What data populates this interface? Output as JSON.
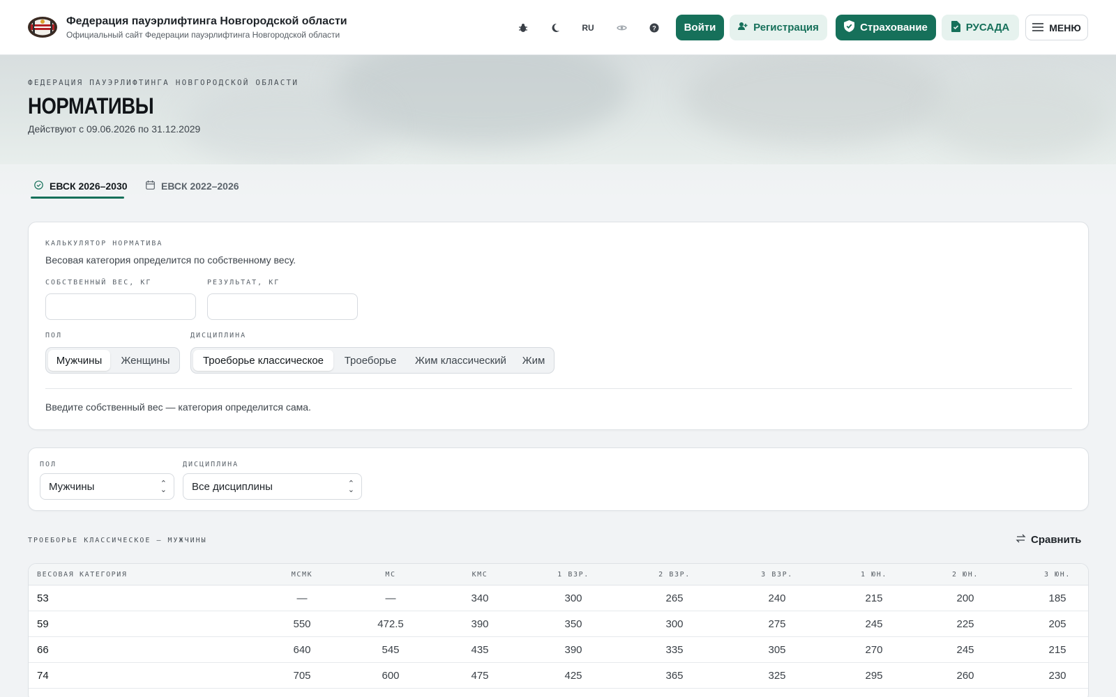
{
  "header": {
    "title": "Федерация пауэрлифтинга Новгородской области",
    "subtitle": "Официальный сайт Федерации пауэрлифтинга Новгородской области",
    "icons": [
      "bug-icon",
      "moon-icon",
      "eye-icon",
      "help-icon"
    ],
    "lang": "RU",
    "login": "Войти",
    "register": "Регистрация",
    "insurance": "Страхование",
    "rusada": "РУСАДА",
    "menu": "МЕНЮ"
  },
  "hero": {
    "kicker": "ФЕДЕРАЦИЯ ПАУЭРЛИФТИНГА НОВГОРОДСКОЙ ОБЛАСТИ",
    "title": "НОРМАТИВЫ",
    "dates": "Действуют с 09.06.2026 по 31.12.2029"
  },
  "tabs": [
    {
      "label": "ЕВСК 2026–2030",
      "active": true
    },
    {
      "label": "ЕВСК 2022–2026",
      "active": false
    }
  ],
  "calculator": {
    "title": "КАЛЬКУЛЯТОР НОРМАТИВА",
    "description": "Весовая категория определится по собственному весу.",
    "bodyweight_label": "СОБСТВЕННЫЙ ВЕС, КГ",
    "bodyweight_value": "",
    "result_label": "РЕЗУЛЬТАТ, КГ",
    "result_value": "",
    "sex_label": "ПОЛ",
    "sex_options": [
      "Мужчины",
      "Женщины"
    ],
    "sex_selected": "Мужчины",
    "discipline_label": "ДИСЦИПЛИНА",
    "discipline_options": [
      "Троеборье классическое",
      "Троеборье",
      "Жим классический",
      "Жим"
    ],
    "discipline_selected": "Троеборье классическое",
    "hint": "Введите собственный вес — категория определится сама."
  },
  "filters": {
    "sex_label": "ПОЛ",
    "sex_value": "Мужчины",
    "discipline_label": "ДИСЦИПЛИНА",
    "discipline_value": "Все дисциплины"
  },
  "table": {
    "title": "ТРОЕБОРЬЕ КЛАССИЧЕСКОЕ — МУЖЧИНЫ",
    "compare": "Сравнить",
    "headers": [
      "ВЕСОВАЯ КАТЕГОРИЯ",
      "МСМК",
      "МС",
      "КМС",
      "1 ВЗР.",
      "2 ВЗР.",
      "3 ВЗР.",
      "1 ЮН.",
      "2 ЮН.",
      "3 ЮН."
    ],
    "rows": [
      [
        "53",
        "—",
        "—",
        "340",
        "300",
        "265",
        "240",
        "215",
        "200",
        "185"
      ],
      [
        "59",
        "550",
        "472.5",
        "390",
        "350",
        "300",
        "275",
        "245",
        "225",
        "205"
      ],
      [
        "66",
        "640",
        "545",
        "435",
        "390",
        "335",
        "305",
        "270",
        "245",
        "215"
      ],
      [
        "74",
        "705",
        "600",
        "475",
        "425",
        "365",
        "325",
        "295",
        "260",
        "230"
      ]
    ]
  },
  "colors": {
    "accent": "#16705a",
    "accent_light": "#e6f2ee"
  }
}
